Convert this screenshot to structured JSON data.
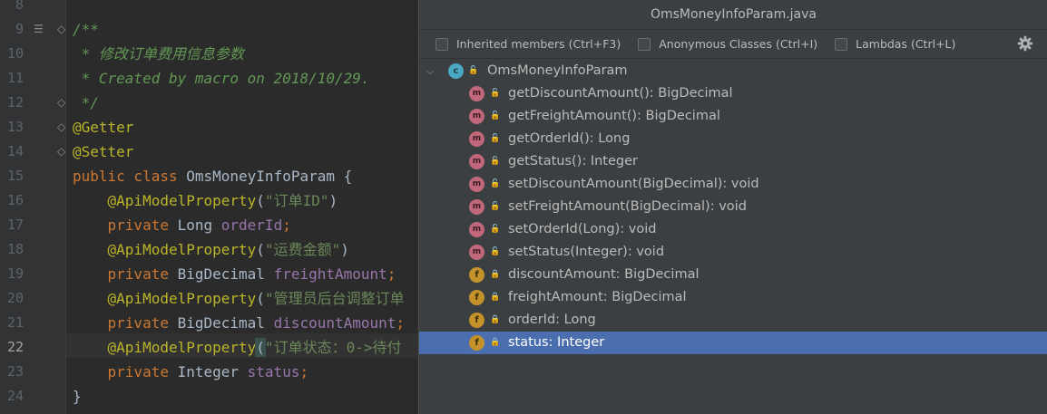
{
  "editor": {
    "active_line": "22",
    "lines": [
      {
        "n": "8",
        "segments": []
      },
      {
        "n": "9",
        "segments": [
          {
            "cls": "c-doc",
            "t": "/**"
          }
        ]
      },
      {
        "n": "10",
        "segments": [
          {
            "cls": "c-doc",
            "t": " * 修改订单费用信息参数"
          }
        ]
      },
      {
        "n": "11",
        "segments": [
          {
            "cls": "c-doc",
            "t": " * Created by macro on 2018/10/29."
          }
        ]
      },
      {
        "n": "12",
        "segments": [
          {
            "cls": "c-doc",
            "t": " */"
          }
        ]
      },
      {
        "n": "13",
        "segments": [
          {
            "cls": "c-ann",
            "t": "@Getter"
          }
        ]
      },
      {
        "n": "14",
        "segments": [
          {
            "cls": "c-ann",
            "t": "@Setter"
          }
        ]
      },
      {
        "n": "15",
        "segments": [
          {
            "cls": "c-kw",
            "t": "public class "
          },
          {
            "cls": "c-pl",
            "t": "OmsMoneyInfoParam {"
          }
        ]
      },
      {
        "n": "16",
        "segments": [
          {
            "cls": "c-pl",
            "t": "    "
          },
          {
            "cls": "c-ann",
            "t": "@ApiModelProperty"
          },
          {
            "cls": "c-pl",
            "t": "("
          },
          {
            "cls": "c-str",
            "t": "\"订单ID\""
          },
          {
            "cls": "c-pl",
            "t": ")"
          }
        ]
      },
      {
        "n": "17",
        "segments": [
          {
            "cls": "c-pl",
            "t": "    "
          },
          {
            "cls": "c-kw",
            "t": "private "
          },
          {
            "cls": "c-pl",
            "t": "Long "
          },
          {
            "cls": "c-fld",
            "t": "orderId"
          },
          {
            "cls": "c-kw",
            "t": ";"
          }
        ]
      },
      {
        "n": "18",
        "segments": [
          {
            "cls": "c-pl",
            "t": "    "
          },
          {
            "cls": "c-ann",
            "t": "@ApiModelProperty"
          },
          {
            "cls": "c-pl",
            "t": "("
          },
          {
            "cls": "c-str",
            "t": "\"运费金额\""
          },
          {
            "cls": "c-pl",
            "t": ")"
          }
        ]
      },
      {
        "n": "19",
        "segments": [
          {
            "cls": "c-pl",
            "t": "    "
          },
          {
            "cls": "c-kw",
            "t": "private "
          },
          {
            "cls": "c-pl",
            "t": "BigDecimal "
          },
          {
            "cls": "c-fld",
            "t": "freightAmount"
          },
          {
            "cls": "c-kw",
            "t": ";"
          }
        ]
      },
      {
        "n": "20",
        "segments": [
          {
            "cls": "c-pl",
            "t": "    "
          },
          {
            "cls": "c-ann",
            "t": "@ApiModelProperty"
          },
          {
            "cls": "c-pl",
            "t": "("
          },
          {
            "cls": "c-str",
            "t": "\"管理员后台调整订单"
          }
        ]
      },
      {
        "n": "21",
        "segments": [
          {
            "cls": "c-pl",
            "t": "    "
          },
          {
            "cls": "c-kw",
            "t": "private "
          },
          {
            "cls": "c-pl",
            "t": "BigDecimal "
          },
          {
            "cls": "c-fld",
            "t": "discountAmount"
          },
          {
            "cls": "c-kw",
            "t": ";"
          }
        ]
      },
      {
        "n": "22",
        "segments": [
          {
            "cls": "c-pl",
            "t": "    "
          },
          {
            "cls": "c-ann",
            "t": "@ApiModelProperty"
          },
          {
            "cls": "c-brk",
            "t": "("
          },
          {
            "cls": "c-str",
            "t": "\"订单状态：0->待付"
          }
        ]
      },
      {
        "n": "23",
        "segments": [
          {
            "cls": "c-pl",
            "t": "    "
          },
          {
            "cls": "c-kw",
            "t": "private "
          },
          {
            "cls": "c-pl",
            "t": "Integer "
          },
          {
            "cls": "c-fld",
            "t": "status"
          },
          {
            "cls": "c-kw",
            "t": ";"
          }
        ]
      },
      {
        "n": "24",
        "segments": [
          {
            "cls": "c-pl",
            "t": "}"
          }
        ]
      }
    ]
  },
  "popup": {
    "title": "OmsMoneyInfoParam.java",
    "options": [
      {
        "label": "Inherited members (Ctrl+F3)"
      },
      {
        "label": "Anonymous Classes (Ctrl+I)"
      },
      {
        "label": "Lambdas (Ctrl+L)"
      }
    ],
    "root": {
      "label": "OmsMoneyInfoParam",
      "icon_letter": "c"
    },
    "members": [
      {
        "kind": "method",
        "label": "getDiscountAmount(): BigDecimal"
      },
      {
        "kind": "method",
        "label": "getFreightAmount(): BigDecimal"
      },
      {
        "kind": "method",
        "label": "getOrderId(): Long"
      },
      {
        "kind": "method",
        "label": "getStatus(): Integer"
      },
      {
        "kind": "method",
        "label": "setDiscountAmount(BigDecimal): void"
      },
      {
        "kind": "method",
        "label": "setFreightAmount(BigDecimal): void"
      },
      {
        "kind": "method",
        "label": "setOrderId(Long): void"
      },
      {
        "kind": "method",
        "label": "setStatus(Integer): void"
      },
      {
        "kind": "field",
        "label": "discountAmount: BigDecimal"
      },
      {
        "kind": "field",
        "label": "freightAmount: BigDecimal"
      },
      {
        "kind": "field",
        "label": "orderId: Long"
      },
      {
        "kind": "field",
        "label": "status: Integer",
        "selected": true
      }
    ],
    "icon_letters": {
      "method": "m",
      "field": "f"
    }
  },
  "colors": {
    "selection": "#4b6eaf",
    "annotation": "#bbb529",
    "keyword": "#cc7832",
    "string": "#6a8759",
    "field": "#9876aa",
    "doc_comment": "#629755"
  }
}
